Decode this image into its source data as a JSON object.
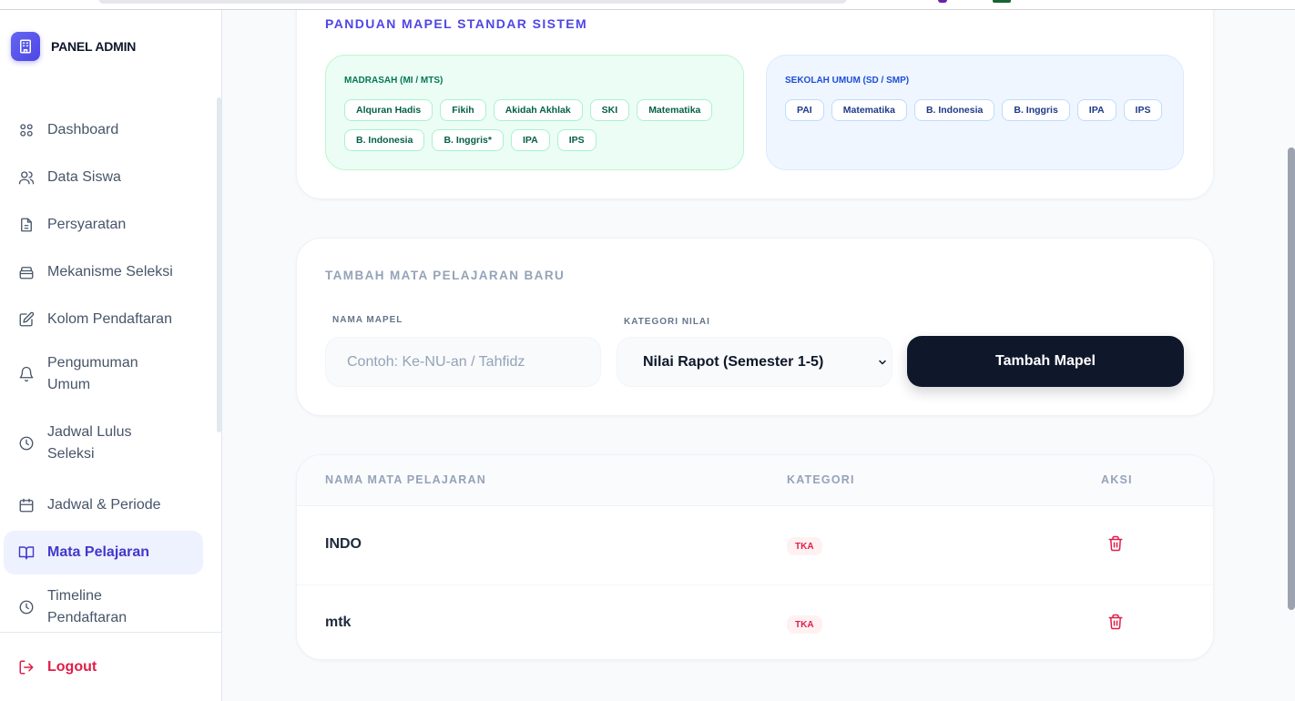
{
  "sidebar": {
    "brand": "PANEL ADMIN",
    "items": [
      {
        "label": "Dashboard"
      },
      {
        "label": "Data Siswa"
      },
      {
        "label": "Persyaratan"
      },
      {
        "label": "Mekanisme Seleksi"
      },
      {
        "label": "Kolom Pendaftaran"
      },
      {
        "label": "Pengumuman Umum"
      },
      {
        "label": "Jadwal Lulus Seleksi"
      },
      {
        "label": "Jadwal & Periode"
      },
      {
        "label": "Mata Pelajaran",
        "active": true
      },
      {
        "label": "Timeline Pendaftaran"
      }
    ],
    "logout": "Logout"
  },
  "guide": {
    "title": "PANDUAN MAPEL STANDAR SISTEM",
    "madrasah": {
      "label": "MADRASAH (MI / MTS)",
      "chips": [
        "Alquran Hadis",
        "Fikih",
        "Akidah Akhlak",
        "SKI",
        "Matematika",
        "B. Indonesia",
        "B. Inggris*",
        "IPA",
        "IPS"
      ]
    },
    "umum": {
      "label": "SEKOLAH UMUM (SD / SMP)",
      "chips": [
        "PAI",
        "Matematika",
        "B. Indonesia",
        "B. Inggris",
        "IPA",
        "IPS"
      ]
    }
  },
  "add_form": {
    "title": "TAMBAH MATA PELAJARAN BARU",
    "name_label": "NAMA MAPEL",
    "name_placeholder": "Contoh: Ke-NU-an / Tahfidz",
    "category_label": "KATEGORI NILAI",
    "category_selected": "Nilai Rapot (Semester 1-5)",
    "submit_label": "Tambah Mapel"
  },
  "table": {
    "headers": {
      "name": "NAMA MATA PELAJARAN",
      "category": "KATEGORI",
      "action": "AKSI"
    },
    "rows": [
      {
        "name": "INDO",
        "category": "TKA"
      },
      {
        "name": "mtk",
        "category": "TKA"
      }
    ]
  },
  "colors": {
    "accent": "#4f46e5",
    "danger": "#e11d48",
    "dark_button": "#0f172a"
  }
}
